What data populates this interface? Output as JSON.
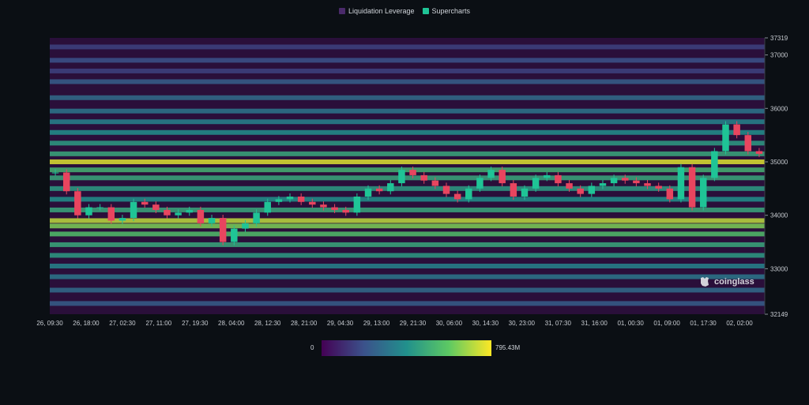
{
  "legend": {
    "items": [
      {
        "label": "Liquidation Leverage",
        "color": "#4a2a6a"
      },
      {
        "label": "Supercharts",
        "color": "#1fc496"
      }
    ]
  },
  "color_scale": {
    "min_label": "0",
    "max_label": "795.43M"
  },
  "watermark": {
    "text": "coinglass"
  },
  "chart_data": {
    "type": "heatmap",
    "title": "",
    "xlabel": "",
    "ylabel": "",
    "x_tick_labels": [
      "26, 09:30",
      "26, 18:00",
      "27, 02:30",
      "27, 11:00",
      "27, 19:30",
      "28, 04:00",
      "28, 12:30",
      "28, 21:00",
      "29, 04:30",
      "29, 13:00",
      "29, 21:30",
      "30, 06:00",
      "30, 14:30",
      "30, 23:00",
      "31, 07:30",
      "31, 16:00",
      "01, 00:30",
      "01, 09:00",
      "01, 17:30",
      "02, 02:00"
    ],
    "y_tick_labels": [
      "37319",
      "37000",
      "36000",
      "35000",
      "34000",
      "33000",
      "32149"
    ],
    "ylim": [
      32149,
      37319
    ],
    "colorbar": {
      "min": 0,
      "max": "795.43M"
    },
    "legend_placement": "top-center",
    "price_series": {
      "name": "Supercharts",
      "note_units": "USD",
      "values": [
        34800,
        34450,
        34000,
        34150,
        34150,
        33900,
        33950,
        34250,
        34200,
        34100,
        34000,
        34050,
        34100,
        33850,
        33950,
        33500,
        33750,
        33850,
        34050,
        34250,
        34300,
        34350,
        34250,
        34200,
        34150,
        34100,
        34050,
        34350,
        34500,
        34450,
        34600,
        34850,
        34750,
        34650,
        34550,
        34400,
        34300,
        34500,
        34700,
        34850,
        34600,
        34350,
        34500,
        34700,
        34750,
        34600,
        34500,
        34400,
        34550,
        34600,
        34700,
        34650,
        34600,
        34550,
        34500,
        34300,
        34900,
        34150,
        34700,
        35200,
        35700,
        35500,
        35200,
        35150
      ]
    },
    "heat_bands": [
      {
        "price": 37150,
        "intensity": 0.2
      },
      {
        "price": 36900,
        "intensity": 0.25
      },
      {
        "price": 36700,
        "intensity": 0.2
      },
      {
        "price": 36500,
        "intensity": 0.3
      },
      {
        "price": 36200,
        "intensity": 0.35
      },
      {
        "price": 35950,
        "intensity": 0.4
      },
      {
        "price": 35750,
        "intensity": 0.45
      },
      {
        "price": 35550,
        "intensity": 0.5
      },
      {
        "price": 35350,
        "intensity": 0.55
      },
      {
        "price": 35150,
        "intensity": 0.6
      },
      {
        "price": 35000,
        "intensity": 0.95
      },
      {
        "price": 34850,
        "intensity": 0.65
      },
      {
        "price": 34700,
        "intensity": 0.6
      },
      {
        "price": 34500,
        "intensity": 0.55
      },
      {
        "price": 34300,
        "intensity": 0.5
      },
      {
        "price": 34100,
        "intensity": 0.6
      },
      {
        "price": 33900,
        "intensity": 0.9
      },
      {
        "price": 33800,
        "intensity": 0.8
      },
      {
        "price": 33650,
        "intensity": 0.7
      },
      {
        "price": 33450,
        "intensity": 0.6
      },
      {
        "price": 33250,
        "intensity": 0.55
      },
      {
        "price": 33050,
        "intensity": 0.45
      },
      {
        "price": 32850,
        "intensity": 0.4
      },
      {
        "price": 32600,
        "intensity": 0.35
      },
      {
        "price": 32350,
        "intensity": 0.3
      }
    ]
  }
}
